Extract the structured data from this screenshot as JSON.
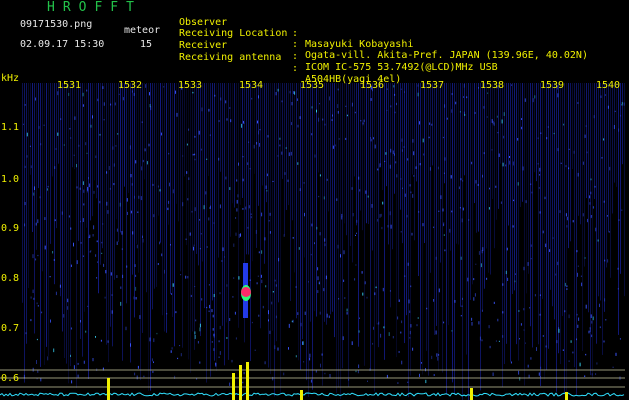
{
  "header": {
    "title": "HROFFT",
    "filename": "09171530.png",
    "meteor_label": "meteor",
    "datetime": "02.09.17 15:30",
    "meteor_count": "15"
  },
  "info": [
    {
      "key": "Observer",
      "value": "Masayuki Kobayashi"
    },
    {
      "key": "Receiving Location",
      "value": "Ogata-vill. Akita-Pref. JAPAN (139.96E, 40.02N)"
    },
    {
      "key": "Receiver",
      "value": "ICOM IC-575 53.7492(@LCD)MHz USB"
    },
    {
      "key": "Receiving antenna",
      "value": "A504HB(yagi 4el)"
    }
  ],
  "axes": {
    "y_unit": "kHz",
    "y_ticks": [
      "1.1",
      "1.0",
      "0.9",
      "0.8",
      "0.7",
      "0.6"
    ],
    "x_ticks": [
      "1531",
      "1532",
      "1533",
      "1534",
      "1535",
      "1536",
      "1537",
      "1538",
      "1539",
      "1540"
    ]
  },
  "colors": {
    "background": "#000000",
    "noise": "#1e2bd0",
    "label_yellow": "#f0f000",
    "title_green": "#23c24a",
    "echo_red": "#ff2a6a",
    "echo_green": "#2cff7a",
    "baseline_cyan": "#30e0ff"
  }
}
